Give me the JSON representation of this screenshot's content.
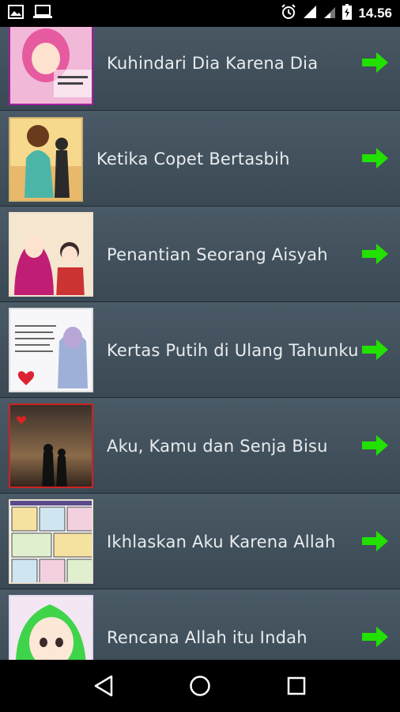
{
  "status_bar": {
    "time": "14.56"
  },
  "list": {
    "items": [
      {
        "title": "Kuhindari Dia Karena Dia",
        "thumb_icon": "illustration-hijab-pink"
      },
      {
        "title": "Ketika Copet Bertasbih",
        "thumb_icon": "illustration-couple-sunset"
      },
      {
        "title": "Penantian Seorang Aisyah",
        "thumb_icon": "illustration-hijab-couple"
      },
      {
        "title": "Kertas Putih di Ulang Tahunku",
        "thumb_icon": "illustration-letter-heart"
      },
      {
        "title": "Aku, Kamu dan Senja Bisu",
        "thumb_icon": "illustration-silhouette-dusk"
      },
      {
        "title": "Ikhlaskan Aku Karena Allah",
        "thumb_icon": "illustration-comic"
      },
      {
        "title": "Rencana Allah itu Indah",
        "thumb_icon": "illustration-green-hijab"
      }
    ]
  },
  "colors": {
    "arrow": "#22e000",
    "list_bg": "#3e4d58",
    "text": "#e8ecef"
  }
}
